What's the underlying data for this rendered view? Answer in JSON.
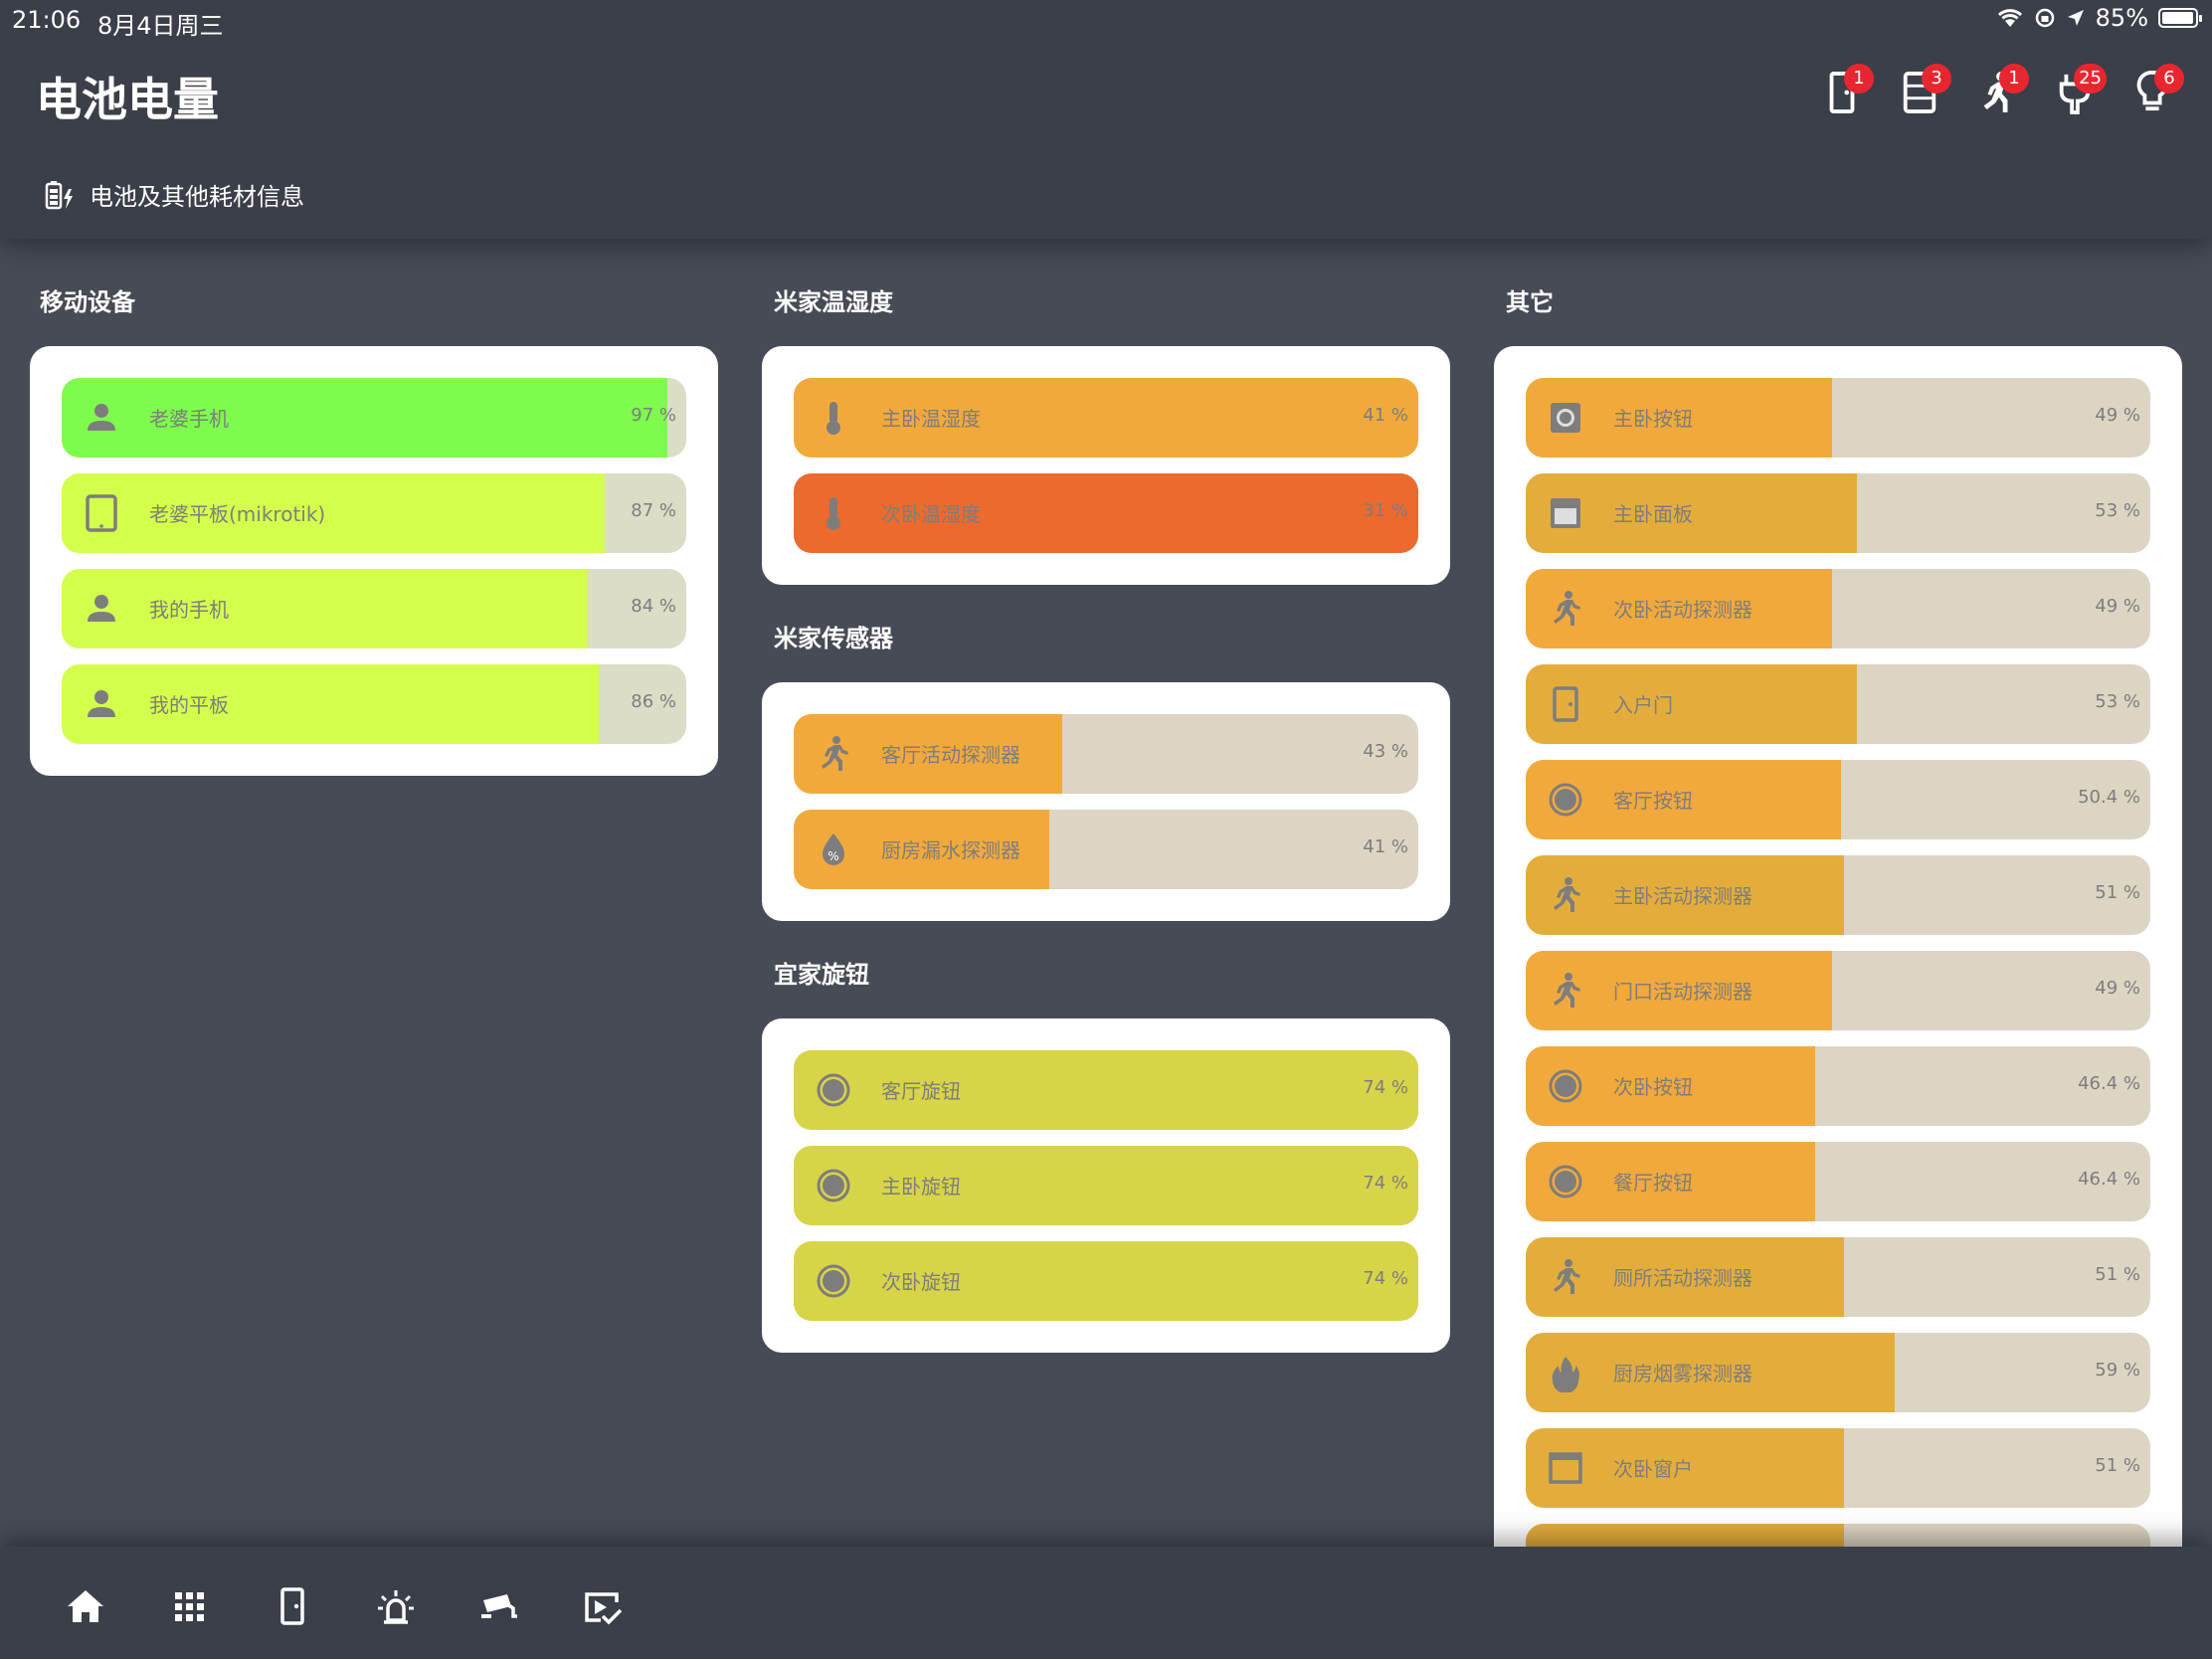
{
  "status_bar": {
    "time": "21:06",
    "date": "8月4日周三",
    "battery": "85%",
    "battery_level": 0.85
  },
  "header": {
    "title": "电池电量",
    "subtitle": "电池及其他耗材信息",
    "badges": [
      {
        "icon": "door-sensor-icon",
        "count": "1"
      },
      {
        "icon": "panel-icon",
        "count": "3"
      },
      {
        "icon": "motion-icon",
        "count": "1"
      },
      {
        "icon": "plug-icon",
        "count": "25"
      },
      {
        "icon": "lightbulb-icon",
        "count": "6"
      }
    ]
  },
  "colors": {
    "green": "#7dfc4d",
    "lime": "#d4fe4c",
    "orange": "#f2a93b",
    "deep_orange": "#ec6a2e",
    "amber": "#e4ad3b",
    "yellow": "#d8d448",
    "track": "#ddd5c3",
    "track_green": "#dbddc6",
    "icon_gray": "#7d7d7d"
  },
  "sections": {
    "mobile": {
      "title": "移动设备",
      "items": [
        {
          "name": "老婆手机",
          "pct": "97 %",
          "level": 97,
          "icon": "person-icon",
          "color": "#7dfc4d",
          "track": "#dbddc6"
        },
        {
          "name": "老婆平板(mikrotik)",
          "pct": "87 %",
          "level": 87,
          "icon": "tablet-icon",
          "color": "#d4fe4c",
          "track": "#dbddc6"
        },
        {
          "name": "我的手机",
          "pct": "84 %",
          "level": 84,
          "icon": "person-icon",
          "color": "#d4fe4c",
          "track": "#dbddc6"
        },
        {
          "name": "我的平板",
          "pct": "86 %",
          "level": 86,
          "icon": "person-icon",
          "color": "#d4fe4c",
          "track": "#dbddc6"
        }
      ]
    },
    "mijia_temp": {
      "title": "米家温湿度",
      "items": [
        {
          "name": "主卧温湿度",
          "pct": "41 %",
          "level": 100,
          "icon": "thermometer-icon",
          "color": "#f2a93b",
          "track": "#ddd5c3"
        },
        {
          "name": "次卧温湿度",
          "pct": "31 %",
          "level": 100,
          "icon": "thermometer-icon",
          "color": "#ec6a2e",
          "track": "#ddd5c3"
        }
      ]
    },
    "mijia_sensor": {
      "title": "米家传感器",
      "items": [
        {
          "name": "客厅活动探测器",
          "pct": "43 %",
          "level": 43,
          "icon": "motion-icon",
          "color": "#f2a93b",
          "track": "#ddd5c3"
        },
        {
          "name": "厨房漏水探测器",
          "pct": "41 %",
          "level": 41,
          "icon": "water-leak-icon",
          "color": "#f2a93b",
          "track": "#ddd5c3"
        }
      ]
    },
    "yijia_knob": {
      "title": "宜家旋钮",
      "items": [
        {
          "name": "客厅旋钮",
          "pct": "74 %",
          "level": 100,
          "icon": "knob-icon",
          "color": "#d8d448",
          "track": "#ddd5c3"
        },
        {
          "name": "主卧旋钮",
          "pct": "74 %",
          "level": 100,
          "icon": "knob-icon",
          "color": "#d8d448",
          "track": "#ddd5c3"
        },
        {
          "name": "次卧旋钮",
          "pct": "74 %",
          "level": 100,
          "icon": "knob-icon",
          "color": "#d8d448",
          "track": "#ddd5c3"
        }
      ]
    },
    "other": {
      "title": "其它",
      "items": [
        {
          "name": "主卧按钮",
          "pct": "49 %",
          "level": 49,
          "icon": "square-button-icon",
          "color": "#f2a93b",
          "track": "#ddd5c3"
        },
        {
          "name": "主卧面板",
          "pct": "53 %",
          "level": 53,
          "icon": "panel-icon",
          "color": "#e4ad3b",
          "track": "#ddd5c3"
        },
        {
          "name": "次卧活动探测器",
          "pct": "49 %",
          "level": 49,
          "icon": "motion-icon",
          "color": "#f2a93b",
          "track": "#ddd5c3"
        },
        {
          "name": "入户门",
          "pct": "53 %",
          "level": 53,
          "icon": "door-sensor-icon",
          "color": "#e4ad3b",
          "track": "#ddd5c3"
        },
        {
          "name": "客厅按钮",
          "pct": "50.4 %",
          "level": 50.4,
          "icon": "round-button-icon",
          "color": "#f2a93b",
          "track": "#ddd5c3"
        },
        {
          "name": "主卧活动探测器",
          "pct": "51 %",
          "level": 51,
          "icon": "motion-icon",
          "color": "#e4ad3b",
          "track": "#ddd5c3"
        },
        {
          "name": "门口活动探测器",
          "pct": "49 %",
          "level": 49,
          "icon": "motion-icon",
          "color": "#f2a93b",
          "track": "#ddd5c3"
        },
        {
          "name": "次卧按钮",
          "pct": "46.4 %",
          "level": 46.4,
          "icon": "round-button-icon",
          "color": "#f2a93b",
          "track": "#ddd5c3"
        },
        {
          "name": "餐厅按钮",
          "pct": "46.4 %",
          "level": 46.4,
          "icon": "round-button-icon",
          "color": "#f2a93b",
          "track": "#ddd5c3"
        },
        {
          "name": "厕所活动探测器",
          "pct": "51 %",
          "level": 51,
          "icon": "motion-icon",
          "color": "#e4ad3b",
          "track": "#ddd5c3"
        },
        {
          "name": "厨房烟雾探测器",
          "pct": "59 %",
          "level": 59,
          "icon": "fire-icon",
          "color": "#e4ad3b",
          "track": "#ddd5c3"
        },
        {
          "name": "次卧窗户",
          "pct": "51 %",
          "level": 51,
          "icon": "window-icon",
          "color": "#e4ad3b",
          "track": "#ddd5c3"
        },
        {
          "name": "",
          "pct": "",
          "level": 51,
          "icon": "",
          "color": "#e4ad3b",
          "track": "#ddd5c3"
        }
      ]
    }
  },
  "bottom_nav": [
    {
      "icon": "home-icon"
    },
    {
      "icon": "grid-icon"
    },
    {
      "icon": "door-sensor-icon"
    },
    {
      "icon": "alarm-light-icon"
    },
    {
      "icon": "cctv-icon"
    },
    {
      "icon": "checklist-icon"
    }
  ]
}
